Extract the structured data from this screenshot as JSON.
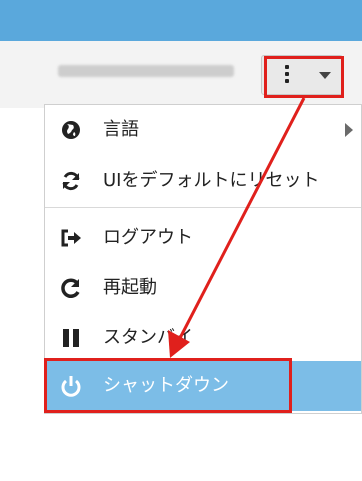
{
  "header": {
    "user_name": "kumo-public-page"
  },
  "menu": {
    "items": [
      {
        "label": "言語",
        "icon": "globe-icon",
        "has_submenu": true
      },
      {
        "label": "UIをデフォルトにリセット",
        "icon": "refresh-icon"
      },
      {
        "label": "ログアウト",
        "icon": "sign-out-icon"
      },
      {
        "label": "再起動",
        "icon": "restart-icon"
      },
      {
        "label": "スタンバイ",
        "icon": "pause-icon"
      },
      {
        "label": "シャットダウン",
        "icon": "power-icon",
        "highlighted": true
      }
    ]
  },
  "colors": {
    "topbar": "#5aa8dc",
    "highlight_bg": "#7cbde7",
    "annotation": "#e0201c"
  }
}
